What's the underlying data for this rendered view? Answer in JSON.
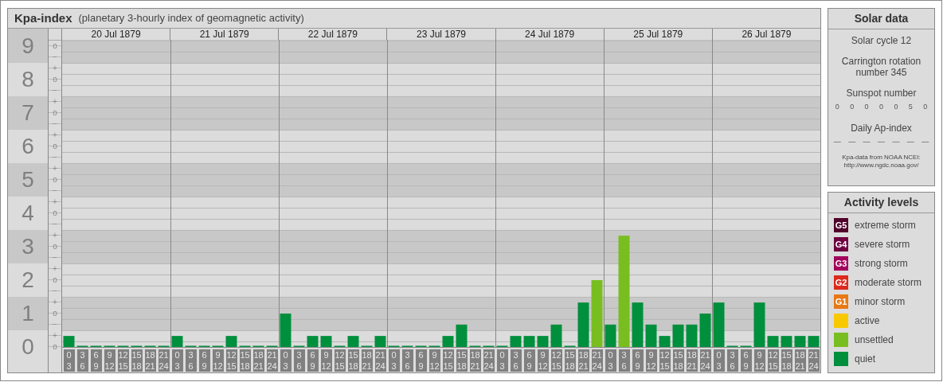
{
  "title": "Kpa-index",
  "subtitle": "(planetary 3-hourly index of geomagnetic activity)",
  "kp_chart": {
    "days": [
      "20 Jul 1879",
      "21 Jul 1879",
      "22 Jul 1879",
      "23 Jul 1879",
      "24 Jul 1879",
      "25 Jul 1879",
      "26 Jul 1879"
    ],
    "scale_marks": [
      "o",
      "−",
      "+",
      "o",
      "−",
      "+",
      "o",
      "−",
      "+",
      "o",
      "−",
      "+",
      "o",
      "−",
      "+",
      "o",
      "−",
      "+",
      "o",
      "−",
      "+",
      "o",
      "−",
      "+",
      "o",
      "−",
      "+",
      "o"
    ],
    "chart_data": {
      "type": "bar",
      "grid": true,
      "ylim": [
        0,
        9.19
      ],
      "yticks": [
        0,
        1,
        2,
        3,
        4,
        5,
        6,
        7,
        8,
        9
      ],
      "categories": [
        "0 3",
        "3 6",
        "6 9",
        "9 12",
        "12 15",
        "15 18",
        "18 21",
        "21 24",
        "0 3",
        "3 6",
        "6 9",
        "9 12",
        "12 15",
        "15 18",
        "18 21",
        "21 24",
        "0 3",
        "3 6",
        "6 9",
        "9 12",
        "12 15",
        "15 18",
        "18 21",
        "21 24",
        "0 3",
        "3 6",
        "6 9",
        "9 12",
        "12 15",
        "15 18",
        "18 21",
        "21 24",
        "0 3",
        "3 6",
        "6 9",
        "9 12",
        "12 15",
        "15 18",
        "18 21",
        "21 24",
        "0 3",
        "3 6",
        "6 9",
        "9 12",
        "12 15",
        "15 18",
        "18 21",
        "21 24",
        "0 3",
        "3 6",
        "6 9",
        "9 12",
        "12 15",
        "15 18",
        "18 21",
        "21 24"
      ],
      "series": [
        {
          "color": "#008f3c",
          "values": [
            0.33,
            0,
            0,
            0,
            0,
            0,
            0,
            0,
            0.33,
            0,
            0,
            0,
            0.33,
            0,
            0,
            0,
            1,
            0,
            0.33,
            0.33,
            0,
            0.33,
            0,
            0.33,
            0,
            0,
            0,
            0,
            0.33,
            0.67,
            0,
            0,
            0,
            0.33,
            0.33,
            0.33,
            0.67,
            0,
            1.33,
            null,
            0.67,
            null,
            1.33,
            0.67,
            0.33,
            0.67,
            0.67,
            1,
            1.33,
            0,
            0,
            1.33,
            0.33,
            0.33,
            0.33,
            0.33
          ]
        },
        {
          "color": "#78be20",
          "values": [
            null,
            null,
            null,
            null,
            null,
            null,
            null,
            null,
            null,
            null,
            null,
            null,
            null,
            null,
            null,
            null,
            null,
            null,
            null,
            null,
            null,
            null,
            null,
            null,
            null,
            null,
            null,
            null,
            null,
            null,
            null,
            null,
            null,
            null,
            null,
            null,
            null,
            null,
            null,
            2,
            null,
            3.33,
            null,
            null,
            null,
            null,
            null,
            null,
            null,
            null,
            null,
            null,
            null,
            null,
            null,
            null
          ]
        }
      ]
    }
  },
  "solar_data": {
    "heading": "Solar data",
    "solar_cycle": "Solar cycle 12",
    "carrington": "Carrington rotation number 345",
    "sunspot_label": "Sunspot number",
    "sunspot_values": [
      "0",
      "0",
      "0",
      "0",
      "0",
      "5",
      "0"
    ],
    "ap_label": "Daily Ap-index",
    "ap_values": [
      "—",
      "—",
      "—",
      "—",
      "—",
      "—",
      "—"
    ],
    "source_lines": [
      "Kpa-data from NOAA NCEI:",
      "http://www.ngdc.noaa.gov/"
    ]
  },
  "activity_levels": {
    "heading": "Activity levels",
    "items": [
      {
        "badge": "G5",
        "label": "extreme storm",
        "color": "#50002a"
      },
      {
        "badge": "G4",
        "label": "severe storm",
        "color": "#6e0040"
      },
      {
        "badge": "G3",
        "label": "strong storm",
        "color": "#a2005c"
      },
      {
        "badge": "G2",
        "label": "moderate storm",
        "color": "#dc2a1e"
      },
      {
        "badge": "G1",
        "label": "minor storm",
        "color": "#e87814"
      },
      {
        "label": "active",
        "color": "#f8c800"
      },
      {
        "label": "unsettled",
        "color": "#78be20"
      },
      {
        "label": "quiet",
        "color": "#008f3c"
      }
    ]
  }
}
